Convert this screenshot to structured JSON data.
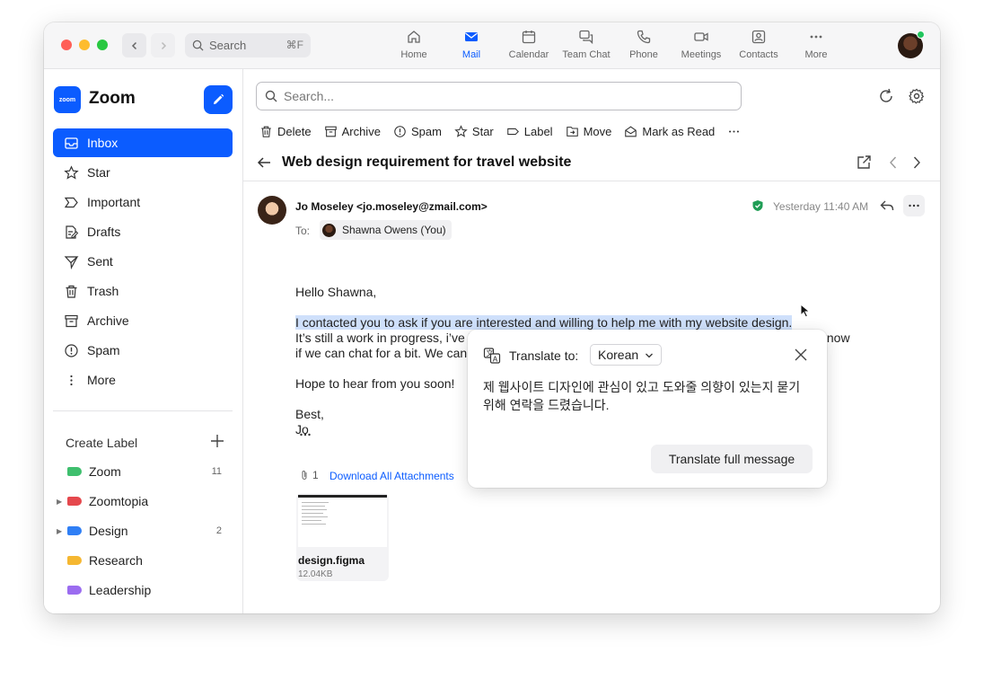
{
  "titlebar": {
    "search_placeholder": "Search",
    "search_shortcut": "⌘F",
    "tabs": [
      {
        "label": "Home",
        "icon": "home-icon"
      },
      {
        "label": "Mail",
        "icon": "mail-icon",
        "active": true
      },
      {
        "label": "Calendar",
        "icon": "calendar-icon"
      },
      {
        "label": "Team Chat",
        "icon": "chat-icon"
      },
      {
        "label": "Phone",
        "icon": "phone-icon"
      },
      {
        "label": "Meetings",
        "icon": "video-icon"
      },
      {
        "label": "Contacts",
        "icon": "contacts-icon"
      },
      {
        "label": "More",
        "icon": "more-dots-icon"
      }
    ]
  },
  "sidebar": {
    "brand": {
      "logo_text": "zoom",
      "name": "Zoom"
    },
    "folders": [
      {
        "label": "Inbox",
        "icon": "inbox-icon",
        "active": true
      },
      {
        "label": "Star",
        "icon": "star-icon"
      },
      {
        "label": "Important",
        "icon": "important-icon"
      },
      {
        "label": "Drafts",
        "icon": "drafts-icon"
      },
      {
        "label": "Sent",
        "icon": "sent-icon"
      },
      {
        "label": "Trash",
        "icon": "trash-icon"
      },
      {
        "label": "Archive",
        "icon": "archive-icon"
      },
      {
        "label": "Spam",
        "icon": "spam-icon"
      },
      {
        "label": "More",
        "icon": "more-vertical-icon"
      }
    ],
    "create_label": "Create Label",
    "labels": [
      {
        "name": "Zoom",
        "color": "#3fbf6e",
        "count": "11",
        "expandable": false
      },
      {
        "name": "Zoomtopia",
        "color": "#e5484d",
        "count": "",
        "expandable": true
      },
      {
        "name": "Design",
        "color": "#2f7ff5",
        "count": "2",
        "expandable": true
      },
      {
        "name": "Research",
        "color": "#f5b731",
        "count": "",
        "expandable": false
      },
      {
        "name": "Leadership",
        "color": "#9b6cf0",
        "count": "",
        "expandable": false
      }
    ]
  },
  "main": {
    "search_placeholder": "Search...",
    "toolbar": [
      {
        "label": "Delete",
        "icon": "trash-icon"
      },
      {
        "label": "Archive",
        "icon": "archive-icon"
      },
      {
        "label": "Spam",
        "icon": "spam-icon"
      },
      {
        "label": "Star",
        "icon": "star-icon"
      },
      {
        "label": "Label",
        "icon": "label-icon"
      },
      {
        "label": "Move",
        "icon": "move-icon"
      },
      {
        "label": "Mark as Read",
        "icon": "mark-read-icon"
      }
    ],
    "subject": "Web design requirement for travel website",
    "email": {
      "sender": "Jo Moseley <jo.moseley@zmail.com>",
      "to_label": "To:",
      "recipient": "Shawna Owens (You)",
      "timestamp": "Yesterday 11:40 AM",
      "greeting": "Hello Shawna,",
      "highlighted_line": "I contacted you to ask if you are interested and willing to help me with my website design.",
      "line2": "It’s still a work in progress, i’ve been using Figma for my prototypes. If you’re interested let me know",
      "line3": "if we can chat for a bit. We can talk about more details, pricing and timeline.",
      "closing_line": "Hope to hear from you soon!",
      "signoff": "Best,",
      "signature": "Jo",
      "attachment_count": "1",
      "download_all": "Download All Attachments",
      "attachment": {
        "name": "design.figma",
        "size": "12.04KB"
      }
    }
  },
  "translate_popup": {
    "label": "Translate to:",
    "language": "Korean",
    "translation": "제 웹사이트 디자인에 관심이 있고 도와줄 의향이 있는지 묻기 위해 연락을 드렸습니다.",
    "full_button": "Translate full message"
  }
}
